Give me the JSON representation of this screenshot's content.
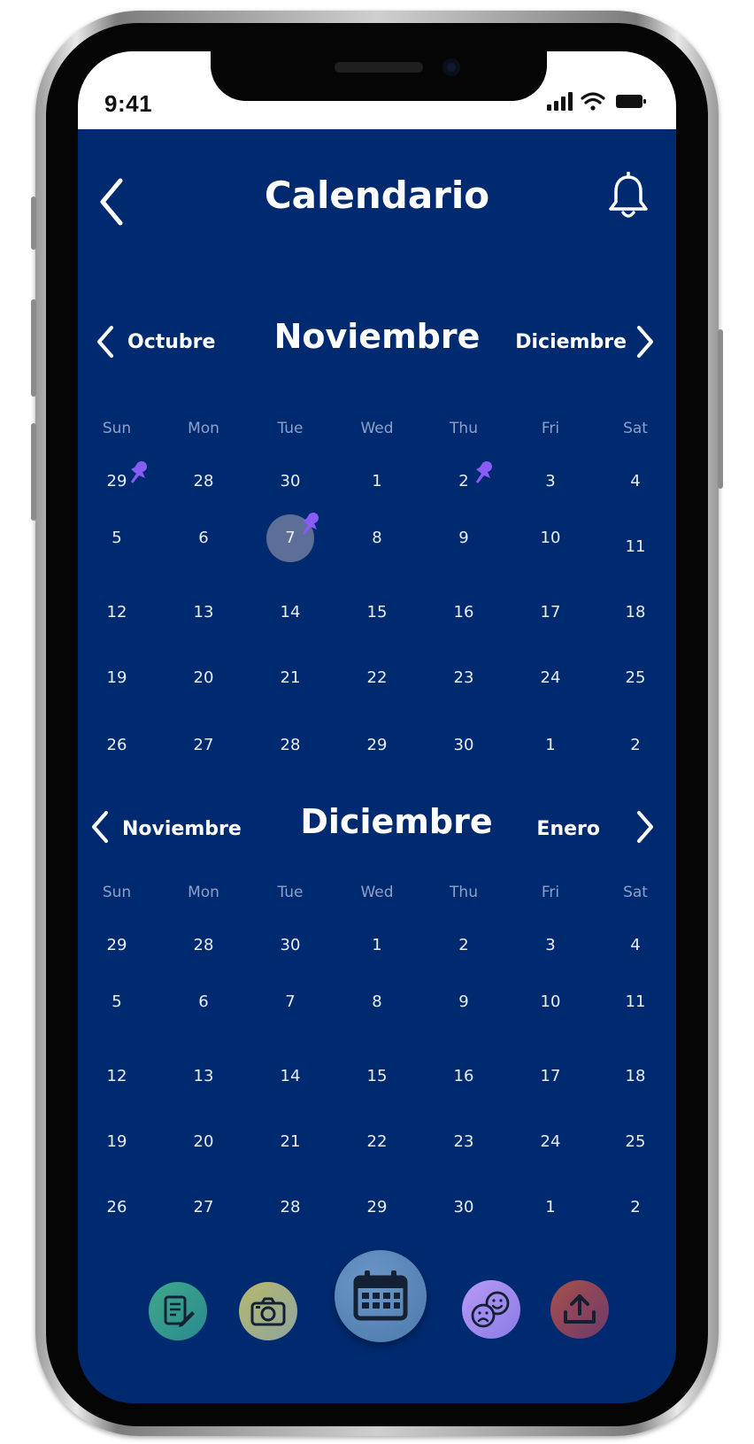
{
  "status_bar": {
    "time": "9:41"
  },
  "header": {
    "title": "Calendario",
    "back_icon": "chevron-left-icon",
    "bell_icon": "bell-icon"
  },
  "colors": {
    "screen_bg": "#002a70",
    "selected_day_bg": "#5d6f98",
    "pin": "#8a5cf6",
    "tab_notes": "#3fa88a",
    "tab_camera": "#b7b86a",
    "tab_calendar": "#5a86b8",
    "tab_mood": "#a08cf0",
    "tab_upload": "#a8504a"
  },
  "weekdays": [
    "Sun",
    "Mon",
    "Tue",
    "Wed",
    "Thu",
    "Fri",
    "Sat"
  ],
  "months": [
    {
      "prev_label": "Octubre",
      "current_label": "Noviembre",
      "next_label": "Diciembre",
      "weeks": [
        [
          "29",
          "28",
          "30",
          "1",
          "2",
          "3",
          "4"
        ],
        [
          "5",
          "6",
          "7",
          "8",
          "9",
          "10",
          "11"
        ],
        [
          "12",
          "13",
          "14",
          "15",
          "16",
          "17",
          "18"
        ],
        [
          "19",
          "20",
          "21",
          "22",
          "23",
          "24",
          "25"
        ],
        [
          "26",
          "27",
          "28",
          "29",
          "30",
          "1",
          "2"
        ]
      ],
      "selected_day": "7",
      "pinned_days": [
        "29",
        "2",
        "7"
      ]
    },
    {
      "prev_label": "Noviembre",
      "current_label": "Diciembre",
      "next_label": "Enero",
      "weeks": [
        [
          "29",
          "28",
          "30",
          "1",
          "2",
          "3",
          "4"
        ],
        [
          "5",
          "6",
          "7",
          "8",
          "9",
          "10",
          "11"
        ],
        [
          "12",
          "13",
          "14",
          "15",
          "16",
          "17",
          "18"
        ],
        [
          "19",
          "20",
          "21",
          "22",
          "23",
          "24",
          "25"
        ],
        [
          "26",
          "27",
          "28",
          "29",
          "30",
          "1",
          "2"
        ]
      ]
    }
  ],
  "tab_bar": [
    {
      "icon": "notes-edit-icon"
    },
    {
      "icon": "camera-icon"
    },
    {
      "icon": "calendar-icon",
      "active": true
    },
    {
      "icon": "mood-faces-icon"
    },
    {
      "icon": "upload-icon"
    }
  ]
}
